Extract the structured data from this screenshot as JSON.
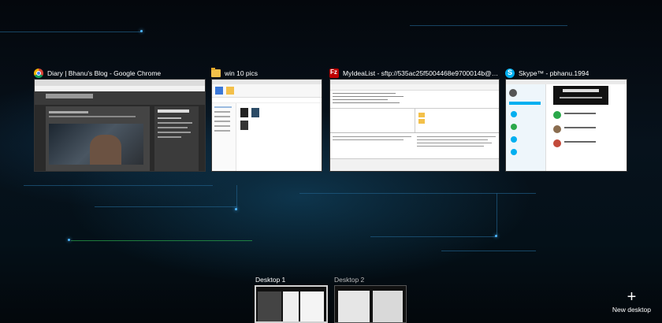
{
  "windows": [
    {
      "title": "Diary | Bhanu's Blog - Google Chrome",
      "icon": "chrome-icon"
    },
    {
      "title": "win 10 pics",
      "icon": "folder-icon"
    },
    {
      "title": "MyIdeaList - sftp://535ac25f5004468e9700014b@we...",
      "icon": "filezilla-icon"
    },
    {
      "title": "Skype™ - pbhanu.1994",
      "icon": "skype-icon"
    }
  ],
  "desktops": [
    {
      "label": "Desktop 1",
      "active": true
    },
    {
      "label": "Desktop 2",
      "active": false
    }
  ],
  "new_desktop": {
    "icon": "plus-icon",
    "label": "New desktop"
  },
  "colors": {
    "background": "#05101a",
    "circuit_blue": "#1f5d86",
    "circuit_green": "#2aa84a",
    "active_border": "#d0d0d0"
  }
}
